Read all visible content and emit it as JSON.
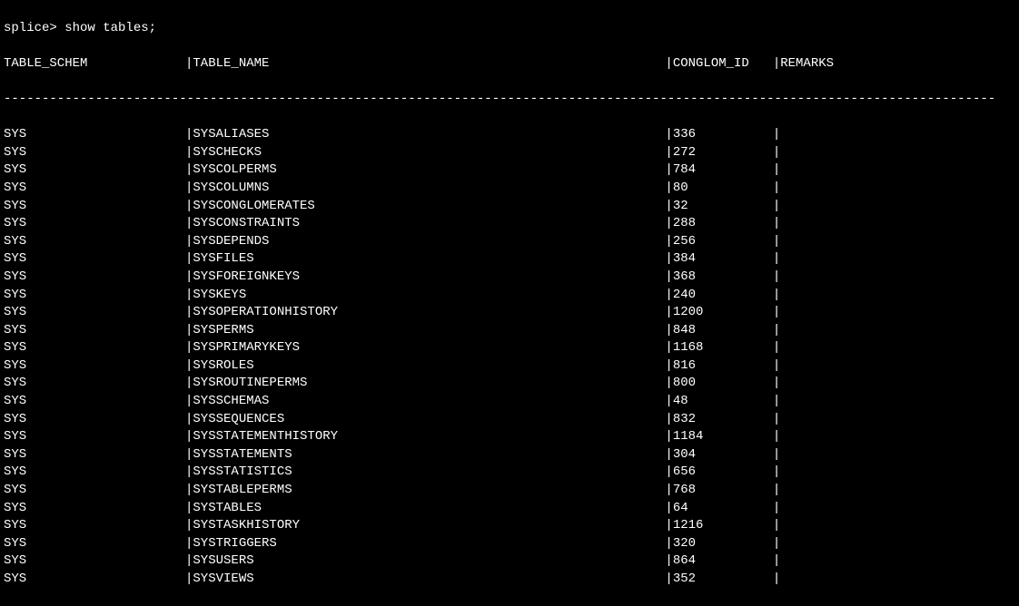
{
  "prompt": "splice> show tables;",
  "columns": {
    "schem": "TABLE_SCHEM",
    "name": "TABLE_NAME",
    "conglom": "CONGLOM_ID",
    "remarks": "REMARKS"
  },
  "rows": [
    {
      "schem": "SYS",
      "name": "SYSALIASES",
      "id": "336",
      "remarks": ""
    },
    {
      "schem": "SYS",
      "name": "SYSCHECKS",
      "id": "272",
      "remarks": ""
    },
    {
      "schem": "SYS",
      "name": "SYSCOLPERMS",
      "id": "784",
      "remarks": ""
    },
    {
      "schem": "SYS",
      "name": "SYSCOLUMNS",
      "id": "80",
      "remarks": ""
    },
    {
      "schem": "SYS",
      "name": "SYSCONGLOMERATES",
      "id": "32",
      "remarks": ""
    },
    {
      "schem": "SYS",
      "name": "SYSCONSTRAINTS",
      "id": "288",
      "remarks": ""
    },
    {
      "schem": "SYS",
      "name": "SYSDEPENDS",
      "id": "256",
      "remarks": ""
    },
    {
      "schem": "SYS",
      "name": "SYSFILES",
      "id": "384",
      "remarks": ""
    },
    {
      "schem": "SYS",
      "name": "SYSFOREIGNKEYS",
      "id": "368",
      "remarks": ""
    },
    {
      "schem": "SYS",
      "name": "SYSKEYS",
      "id": "240",
      "remarks": ""
    },
    {
      "schem": "SYS",
      "name": "SYSOPERATIONHISTORY",
      "id": "1200",
      "remarks": ""
    },
    {
      "schem": "SYS",
      "name": "SYSPERMS",
      "id": "848",
      "remarks": ""
    },
    {
      "schem": "SYS",
      "name": "SYSPRIMARYKEYS",
      "id": "1168",
      "remarks": ""
    },
    {
      "schem": "SYS",
      "name": "SYSROLES",
      "id": "816",
      "remarks": ""
    },
    {
      "schem": "SYS",
      "name": "SYSROUTINEPERMS",
      "id": "800",
      "remarks": ""
    },
    {
      "schem": "SYS",
      "name": "SYSSCHEMAS",
      "id": "48",
      "remarks": ""
    },
    {
      "schem": "SYS",
      "name": "SYSSEQUENCES",
      "id": "832",
      "remarks": ""
    },
    {
      "schem": "SYS",
      "name": "SYSSTATEMENTHISTORY",
      "id": "1184",
      "remarks": ""
    },
    {
      "schem": "SYS",
      "name": "SYSSTATEMENTS",
      "id": "304",
      "remarks": ""
    },
    {
      "schem": "SYS",
      "name": "SYSSTATISTICS",
      "id": "656",
      "remarks": ""
    },
    {
      "schem": "SYS",
      "name": "SYSTABLEPERMS",
      "id": "768",
      "remarks": ""
    },
    {
      "schem": "SYS",
      "name": "SYSTABLES",
      "id": "64",
      "remarks": ""
    },
    {
      "schem": "SYS",
      "name": "SYSTASKHISTORY",
      "id": "1216",
      "remarks": ""
    },
    {
      "schem": "SYS",
      "name": "SYSTRIGGERS",
      "id": "320",
      "remarks": ""
    },
    {
      "schem": "SYS",
      "name": "SYSUSERS",
      "id": "864",
      "remarks": ""
    },
    {
      "schem": "SYS",
      "name": "SYSVIEWS",
      "id": "352",
      "remarks": ""
    }
  ]
}
